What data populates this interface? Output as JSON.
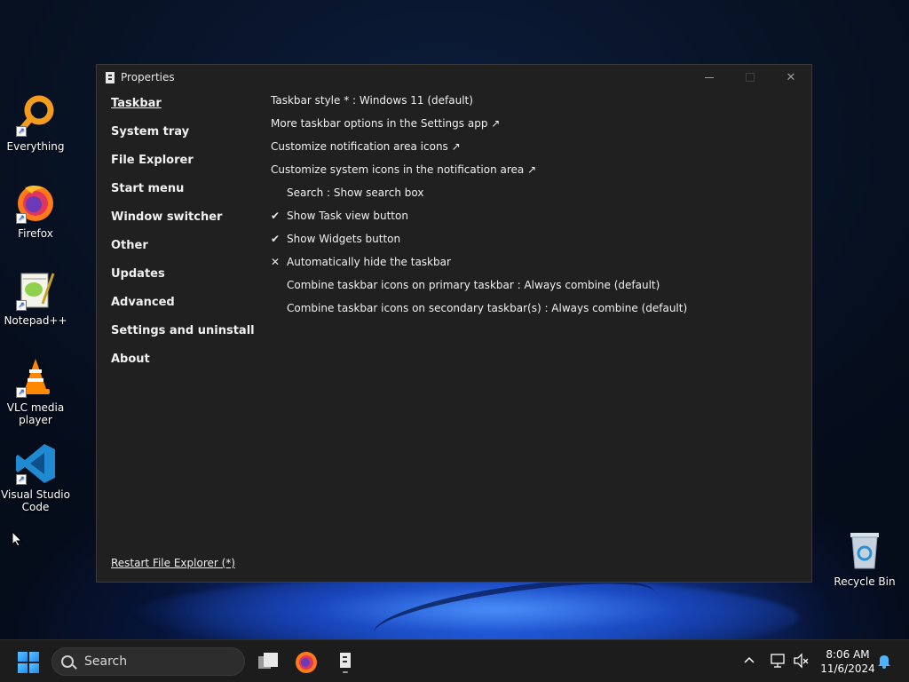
{
  "desktop": {
    "icons": [
      {
        "label": "Everything"
      },
      {
        "label": "Firefox"
      },
      {
        "label": "Notepad++"
      },
      {
        "label": "VLC media player"
      },
      {
        "label": "Visual Studio Code"
      }
    ],
    "recycle_bin": {
      "label": "Recycle Bin"
    }
  },
  "window": {
    "title": "Properties",
    "nav": [
      {
        "label": "Taskbar",
        "active": true
      },
      {
        "label": "System tray"
      },
      {
        "label": "File Explorer"
      },
      {
        "label": "Start menu"
      },
      {
        "label": "Window switcher"
      },
      {
        "label": "Other"
      },
      {
        "label": "Updates"
      },
      {
        "label": "Advanced"
      },
      {
        "label": "Settings and uninstall"
      },
      {
        "label": "About"
      }
    ],
    "options": [
      {
        "label": "Taskbar style * : Windows 11 (default)",
        "mark": ""
      },
      {
        "label": "More taskbar options in the Settings app ↗",
        "mark": ""
      },
      {
        "label": "Customize notification area icons ↗",
        "mark": ""
      },
      {
        "label": "Customize system icons in the notification area ↗",
        "mark": ""
      },
      {
        "label": "Search : Show search box",
        "mark": ""
      },
      {
        "label": "Show Task view button",
        "mark": "✔"
      },
      {
        "label": "Show Widgets button",
        "mark": "✔"
      },
      {
        "label": "Automatically hide the taskbar",
        "mark": "✕"
      },
      {
        "label": "Combine taskbar icons on primary taskbar : Always combine (default)",
        "mark": ""
      },
      {
        "label": "Combine taskbar icons on secondary taskbar(s) : Always combine (default)",
        "mark": ""
      }
    ],
    "restart_label": "Restart File Explorer (*)"
  },
  "taskbar": {
    "search_label": "Search",
    "time": "8:06 AM",
    "date": "11/6/2024"
  }
}
